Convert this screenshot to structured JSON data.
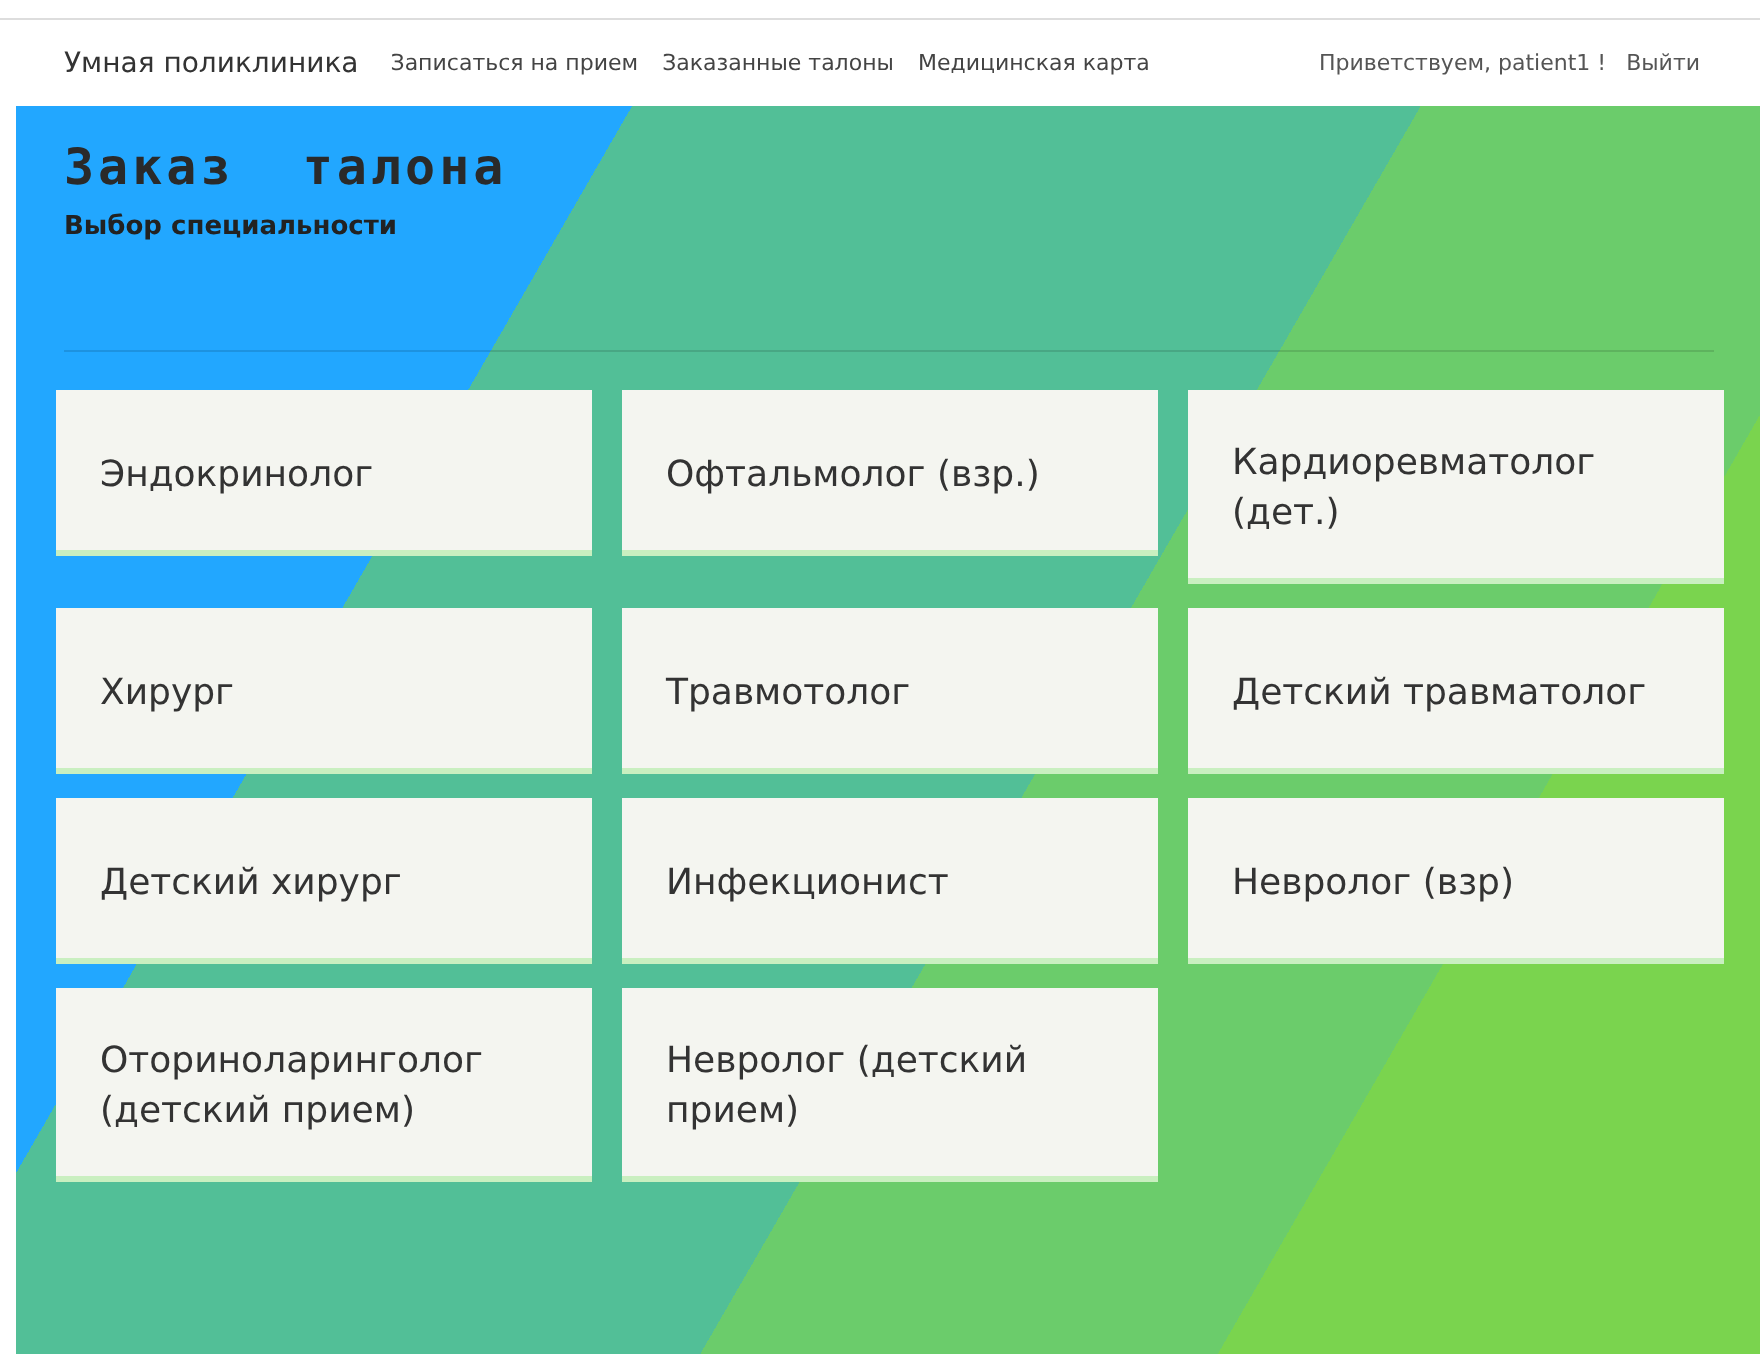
{
  "navbar": {
    "brand": "Умная поликлиника",
    "links": [
      "Записаться на прием",
      "Заказанные талоны",
      "Медицинская карта"
    ],
    "greeting": "Приветствуем, patient1 !",
    "logout": "Выйти"
  },
  "header": {
    "title": "Заказ  талона",
    "subtitle": "Выбор специальности"
  },
  "specialties": [
    {
      "name": "Эндокринолог"
    },
    {
      "name": "Офтальмолог (взр.)"
    },
    {
      "name": "Кардиоревматолог (дет.)"
    },
    {
      "name": "Хирург"
    },
    {
      "name": "Травмотолог"
    },
    {
      "name": "Детский травматолог"
    },
    {
      "name": "Детский хирург"
    },
    {
      "name": "Инфекционист"
    },
    {
      "name": "Невролог (взр)"
    },
    {
      "name": "Оториноларинголог (детский прием)"
    },
    {
      "name": "Невролог (детский прием)"
    }
  ]
}
